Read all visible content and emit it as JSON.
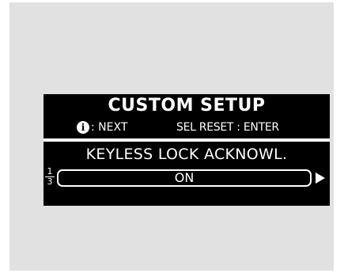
{
  "screen": {
    "title": "CUSTOM SETUP",
    "hint": {
      "info_glyph": "i",
      "next_label": ": NEXT",
      "reset_label": "SEL RESET : ENTER"
    },
    "item": {
      "title": "KEYLESS LOCK ACKNOWL.",
      "value": "ON"
    },
    "page": {
      "current": "1",
      "total": "3"
    }
  },
  "colors": {
    "background": "#e1e1e1",
    "display": "#000000",
    "text": "#ffffff"
  },
  "icons": {
    "info": "info-icon",
    "arrow": "right-arrow-icon"
  }
}
